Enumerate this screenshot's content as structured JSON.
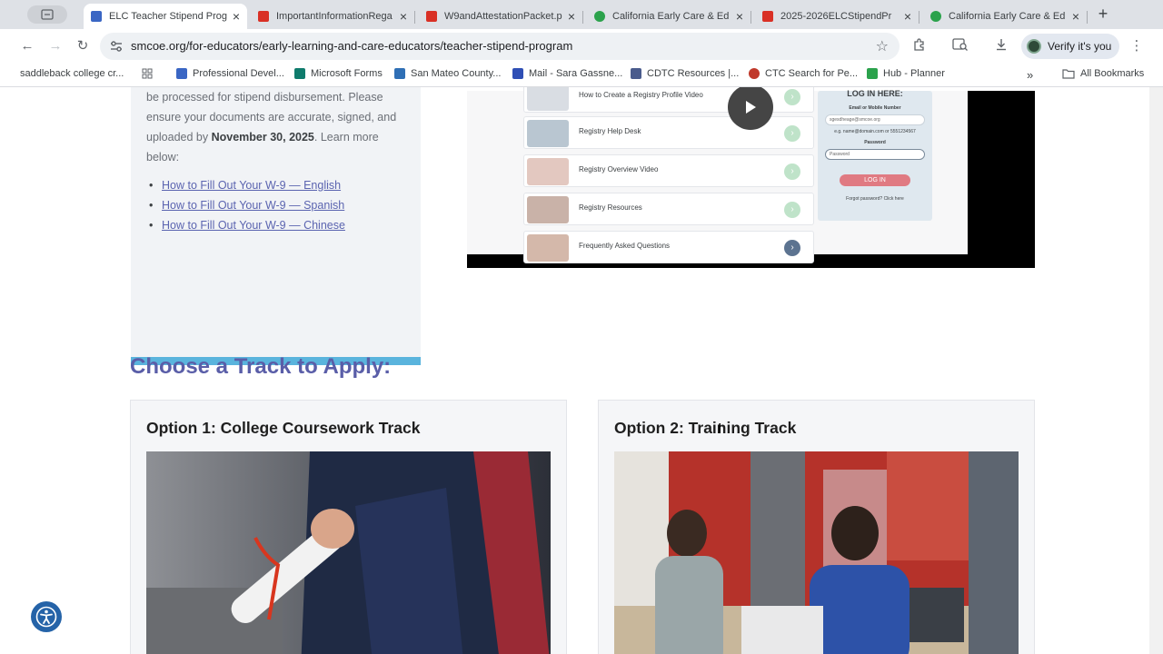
{
  "browser": {
    "tabs": [
      {
        "title": "ELC Teacher Stipend Prog",
        "favicon_color": "#3a66c4",
        "active": true
      },
      {
        "title": "ImportantInformationRega",
        "favicon_color": "#d93025",
        "active": false
      },
      {
        "title": "W9andAttestationPacket.p",
        "favicon_color": "#d93025",
        "active": false
      },
      {
        "title": "California Early Care & Ed",
        "favicon_color": "#2ba24c",
        "active": false
      },
      {
        "title": "2025-2026ELCStipendPr",
        "favicon_color": "#d93025",
        "active": false
      },
      {
        "title": "California Early Care & Ed",
        "favicon_color": "#2ba24c",
        "active": false
      }
    ],
    "url": "smcoe.org/for-educators/early-learning-and-care-educators/teacher-stipend-program",
    "verify_label": "Verify it's you",
    "bookmarks": [
      {
        "label": "saddleback college cr...",
        "color": ""
      },
      {
        "label": "Professional Devel...",
        "color": "#3a66c4"
      },
      {
        "label": "Microsoft Forms",
        "color": "#0f7b6c"
      },
      {
        "label": "San Mateo County...",
        "color": "#2f6fb5"
      },
      {
        "label": "Mail - Sara Gassne...",
        "color": "#2f4fb5"
      },
      {
        "label": "CDTC Resources |...",
        "color": "#4a5b8c"
      },
      {
        "label": "CTC Search for Pe...",
        "color": "#c0392b"
      },
      {
        "label": "Hub - Planner",
        "color": "#2ba24c"
      }
    ],
    "all_bookmarks_label": "All Bookmarks"
  },
  "info": {
    "text_before": "be processed for stipend disbursement. Please ensure your documents are accurate, signed, and uploaded by",
    "deadline": "November 30, 2025",
    "text_after": ". Learn more below:",
    "links": [
      "How to Fill Out Your W-9 — English",
      "How to Fill Out Your W-9 — Spanish",
      "How to Fill Out Your W-9 — Chinese"
    ]
  },
  "video": {
    "rows": [
      "How to Create a Registry Profile Video",
      "Registry Help Desk",
      "Registry Overview Video",
      "Registry Resources",
      "Frequently Asked Questions"
    ],
    "login": {
      "title": "LOG IN HERE:",
      "email_label": "Email or Mobile Number",
      "email_value": "sgesdheage@smcoe.org",
      "email_hint": "e.g. name@domain.com or 5551234567",
      "password_label": "Password",
      "password_placeholder": "Password",
      "button": "LOG IN",
      "forgot": "Forgot password? Click here"
    }
  },
  "tracks": {
    "heading": "Choose a Track to Apply:",
    "option1": "Option 1: College Coursework Track",
    "option2": "Option 2: Training Track"
  },
  "colors": {
    "heading": "#5a5ea8",
    "link": "#5b64b0",
    "card_accent": "#5ab4dd"
  }
}
